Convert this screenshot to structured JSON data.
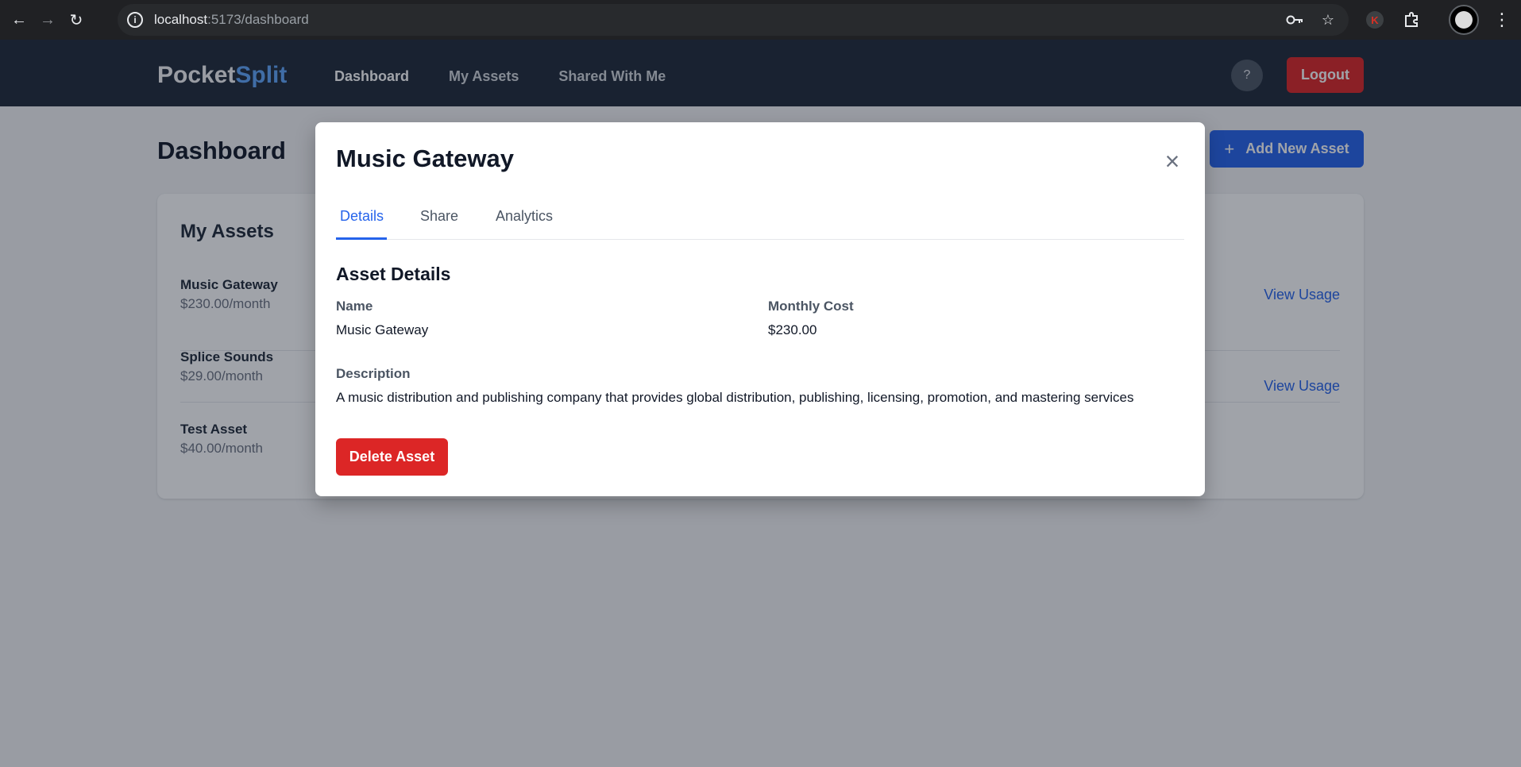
{
  "browser": {
    "url_host": "localhost",
    "url_path": ":5173/dashboard",
    "ext_k_label": "K"
  },
  "header": {
    "logo_part1": "Pocket",
    "logo_part2": "Split",
    "nav": [
      "Dashboard",
      "My Assets",
      "Shared With Me"
    ],
    "help_label": "?",
    "logout_label": "Logout"
  },
  "page": {
    "title": "Dashboard",
    "add_button": "Add New Asset"
  },
  "assets": {
    "title": "My Assets",
    "items": [
      {
        "name": "Music Gateway",
        "price": "$230.00/month",
        "action": "View Usage"
      },
      {
        "name": "Splice Sounds",
        "price": "$29.00/month",
        "action": "View Usage"
      },
      {
        "name": "Test Asset",
        "price": "$40.00/month",
        "action": ""
      }
    ]
  },
  "modal": {
    "title": "Music Gateway",
    "tabs": [
      "Details",
      "Share",
      "Analytics"
    ],
    "active_tab": "Details",
    "section_title": "Asset Details",
    "name_label": "Name",
    "name_value": "Music Gateway",
    "cost_label": "Monthly Cost",
    "cost_value": "$230.00",
    "description_label": "Description",
    "description_value": "A music distribution and publishing company that provides global distribution, publishing, licensing, promotion, and mastering services",
    "delete_label": "Delete Asset"
  }
}
